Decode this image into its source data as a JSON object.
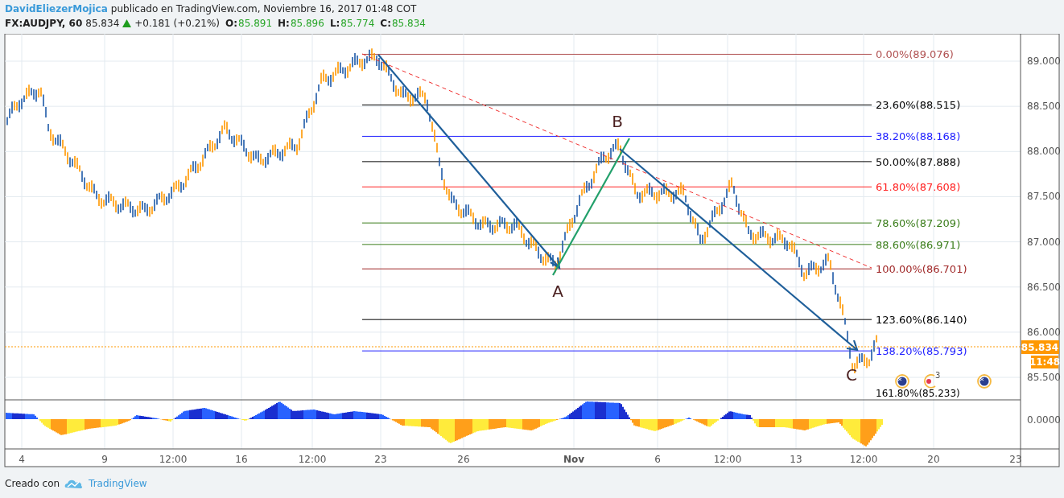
{
  "header": {
    "author": "DavidEliezerMojica",
    "published": "publicado en TradingView.com, Noviembre 16, 2017 01:48 COT",
    "symbol": "FX:AUDJPY, 60",
    "last": "85.834",
    "change": "+0.181 (+0.21%)",
    "ohlc": [
      {
        "label": "O:",
        "value": "85.891"
      },
      {
        "label": "H:",
        "value": "85.896"
      },
      {
        "label": "L:",
        "value": "85.774"
      },
      {
        "label": "C:",
        "value": "85.834"
      }
    ]
  },
  "chart": {
    "fib_levels": [
      {
        "label": "0.00%(89.076)",
        "color": "#b05050"
      },
      {
        "label": "23.60%(88.515)",
        "color": "#000000"
      },
      {
        "label": "38.20%(88.168)",
        "color": "#2020ff"
      },
      {
        "label": "50.00%(87.888)",
        "color": "#000000"
      },
      {
        "label": "61.80%(87.608)",
        "color": "#ff2020"
      },
      {
        "label": "78.60%(87.209)",
        "color": "#3a7d1a"
      },
      {
        "label": "88.60%(86.971)",
        "color": "#3a7d1a"
      },
      {
        "label": "100.00%(86.701)",
        "color": "#a02828"
      },
      {
        "label": "123.60%(86.140)",
        "color": "#000000"
      },
      {
        "label": "138.20%(85.793)",
        "color": "#2020ff"
      },
      {
        "label": "161.80%(85.233)",
        "color": "#000000"
      }
    ],
    "wave_labels": [
      "A",
      "B",
      "C"
    ],
    "price_ticks": [
      "89.000",
      "88.500",
      "88.000",
      "87.500",
      "87.000",
      "86.500",
      "86.000",
      "85.500"
    ],
    "current_price": "85.834",
    "countdown": "11:48",
    "event_count": "3",
    "indicator_tick": "0.0000",
    "time_ticks": [
      "4",
      "9",
      "12:00",
      "16",
      "12:00",
      "23",
      "26",
      "Nov",
      "6",
      "12:00",
      "13",
      "12:00",
      "20",
      "23"
    ]
  },
  "footer": {
    "created_with": "Creado con",
    "brand": "TradingView"
  }
}
